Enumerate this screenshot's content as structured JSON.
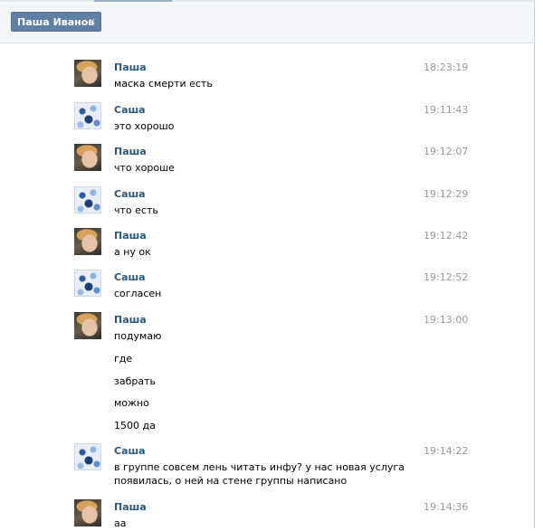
{
  "tab": {
    "label": "Паша Иванов",
    "close": "✕"
  },
  "messages": [
    {
      "author": "Паша",
      "time": "18:23:19",
      "lines": [
        "маска смерти есть"
      ]
    },
    {
      "author": "Саша",
      "time": "19:11:43",
      "lines": [
        "это хорошо"
      ]
    },
    {
      "author": "Паша",
      "time": "19:12:07",
      "lines": [
        "что хороше"
      ]
    },
    {
      "author": "Саша",
      "time": "19:12:29",
      "lines": [
        "что есть"
      ]
    },
    {
      "author": "Паша",
      "time": "19:12:42",
      "lines": [
        "а ну ок"
      ]
    },
    {
      "author": "Саша",
      "time": "19:12:52",
      "lines": [
        "согласен"
      ]
    },
    {
      "author": "Паша",
      "time": "19:13:00",
      "lines": [
        "подумаю",
        "где",
        "забрать",
        "можно",
        "1500 да"
      ]
    },
    {
      "author": "Саша",
      "time": "19:14:22",
      "lines": [
        "в группе совсем лень читать инфу? у нас новая услуга",
        "появилась, о ней на стене группы написано"
      ]
    },
    {
      "author": "Паша",
      "time": "19:14:36",
      "lines": [
        "аа"
      ]
    }
  ]
}
